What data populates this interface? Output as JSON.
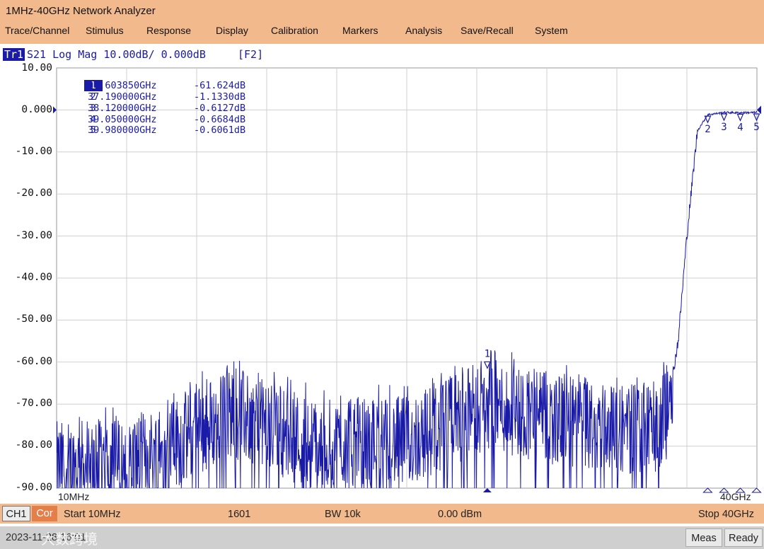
{
  "window": {
    "title": "1MHz-40GHz Network Analyzer"
  },
  "menu": [
    "Trace/Channel",
    "Stimulus",
    "Response",
    "Display",
    "Calibration",
    "Markers",
    "Analysis",
    "Save/Recall",
    "System"
  ],
  "trace": {
    "id": "Tr1",
    "description": "S21 Log Mag 10.00dB/ 0.000dB",
    "softkey": "[F2]",
    "color": "#1a1aa8"
  },
  "y_axis": {
    "labels": [
      "10.00",
      "0.000",
      "-10.00",
      "-20.00",
      "-30.00",
      "-40.00",
      "-50.00",
      "-60.00",
      "-70.00",
      "-80.00",
      "-90.00"
    ],
    "max_db": 10,
    "min_db": -90,
    "ref_db": 0
  },
  "x_axis": {
    "start_label": "10MHz",
    "stop_label": "40GHz",
    "start_ghz": 0.01,
    "stop_ghz": 40
  },
  "markers": [
    {
      "num": "1",
      "freq": "24.603850GHz",
      "amp": "-61.624dB",
      "freq_ghz": 24.60385,
      "amp_db": -61.624,
      "active": true
    },
    {
      "num": "2",
      "freq": "37.190000GHz",
      "amp": "-1.1330dB",
      "freq_ghz": 37.19,
      "amp_db": -1.133,
      "active": false
    },
    {
      "num": "3",
      "freq": "38.120000GHz",
      "amp": "-0.6127dB",
      "freq_ghz": 38.12,
      "amp_db": -0.6127,
      "active": false
    },
    {
      "num": "4",
      "freq": "39.050000GHz",
      "amp": "-0.6684dB",
      "freq_ghz": 39.05,
      "amp_db": -0.6684,
      "active": false
    },
    {
      "num": "5",
      "freq": "39.980000GHz",
      "amp": "-0.6061dB",
      "freq_ghz": 39.98,
      "amp_db": -0.6061,
      "active": false
    }
  ],
  "channel": {
    "ch": "CH1",
    "cor": "Cor",
    "start": "Start 10MHz",
    "points": "1601",
    "bw": "BW 10k",
    "power": "0.00 dBm",
    "stop": "Stop 40GHz"
  },
  "status": {
    "datetime": "2023-11-28 16:01",
    "watermark": "大数跨境",
    "meas": "Meas",
    "ready": "Ready"
  },
  "chart_data": {
    "type": "line",
    "series": [
      {
        "values_note": "",
        "x_ghz": [
          0.01,
          4,
          6,
          10,
          15,
          20,
          24.6,
          30,
          34,
          34.8,
          35.5,
          36,
          36.6,
          37.19,
          38.12,
          39.05,
          39.98,
          40
        ],
        "y_db": [
          -85,
          -84,
          -81,
          -72,
          -80,
          -79,
          -70,
          -75,
          -76,
          -73,
          -55,
          -30,
          -5,
          -1.133,
          -0.6127,
          -0.6684,
          -0.6061,
          -0.5
        ]
      }
    ],
    "xlim": [
      0.01,
      40
    ],
    "ylim": [
      -90,
      10
    ],
    "grid": true
  }
}
